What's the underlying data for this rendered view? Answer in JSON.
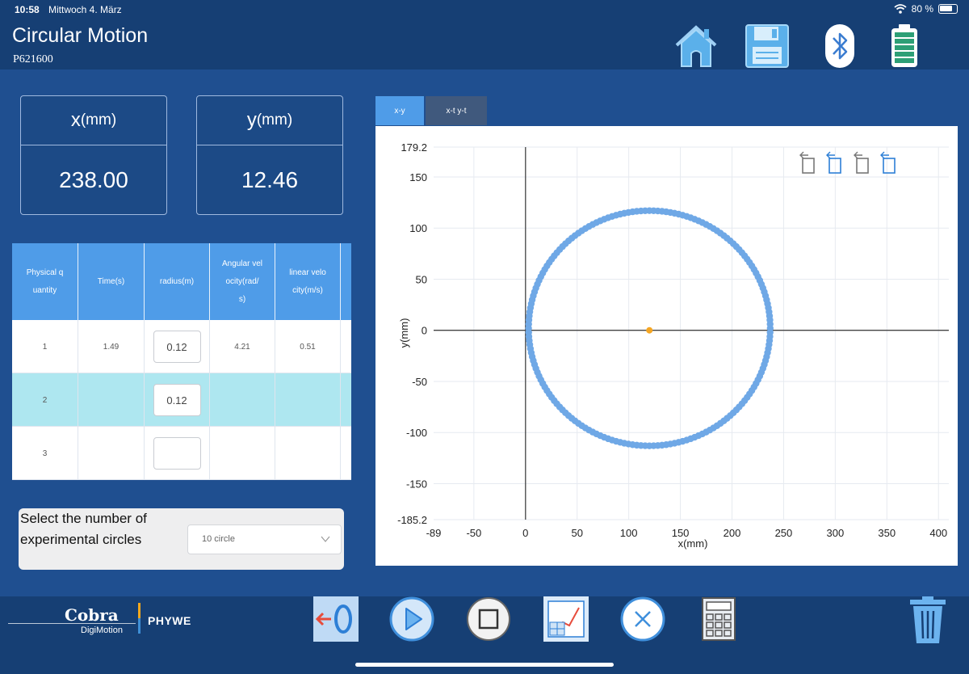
{
  "status": {
    "time": "10:58",
    "date": "Mittwoch 4. März",
    "battery": "80 %"
  },
  "header": {
    "title": "Circular Motion",
    "subtitle": "P621600"
  },
  "readouts": {
    "x": {
      "base": "x",
      "unit": "(mm)",
      "value": "238.00"
    },
    "y": {
      "base": "y",
      "unit": "(mm)",
      "value": "12.46"
    }
  },
  "table": {
    "headers": [
      "Physical q\nuantity",
      "Time(s)",
      "radius(m)",
      "Angular vel\nocity(rad/\ns)",
      "linear velo\ncity(m/s)"
    ],
    "rows": [
      {
        "n": "1",
        "time": "1.49",
        "radius": "0.12",
        "omega": "4.21",
        "v": "0.51"
      },
      {
        "n": "2",
        "time": "",
        "radius": "0.12",
        "omega": "",
        "v": ""
      },
      {
        "n": "3",
        "time": "",
        "radius": "",
        "omega": "",
        "v": ""
      }
    ]
  },
  "circles": {
    "label": "Select the number of experimental circles",
    "selected": "10 circle"
  },
  "tabs": [
    "x-y",
    "x-t y-t"
  ],
  "brand": {
    "cobra": "Cobra",
    "digimotion": "DigiMotion",
    "phywe": "PHYWE"
  },
  "colors": {
    "accent": "#4f9ce8",
    "header": "#163f74",
    "body": "#1f4f90",
    "selected_row": "#aee7f0",
    "data": "#6fa8e6",
    "center": "#f5a623"
  },
  "chart_data": {
    "type": "scatter",
    "xlabel": "x(mm)",
    "ylabel": "y(mm)",
    "xlim": [
      -89,
      410
    ],
    "ylim": [
      -185.2,
      179.2
    ],
    "xticks": [
      "-89",
      "-50",
      "0",
      "50",
      "100",
      "150",
      "200",
      "250",
      "300",
      "350",
      "400"
    ],
    "xtick_values": [
      -89,
      -50,
      0,
      50,
      100,
      150,
      200,
      250,
      300,
      350,
      400
    ],
    "yticks": [
      "179.2",
      "150",
      "100",
      "50",
      "0",
      "-50",
      "-100",
      "-150",
      "-185.2"
    ],
    "ytick_values": [
      179.2,
      150,
      100,
      50,
      0,
      -50,
      -100,
      -150,
      -185.2
    ],
    "grid": true,
    "series": [
      {
        "center": [
          120,
          2
        ],
        "radius_x": 117,
        "radius_y": 115
      }
    ],
    "center_point": {
      "x": 120,
      "y": 0
    }
  }
}
